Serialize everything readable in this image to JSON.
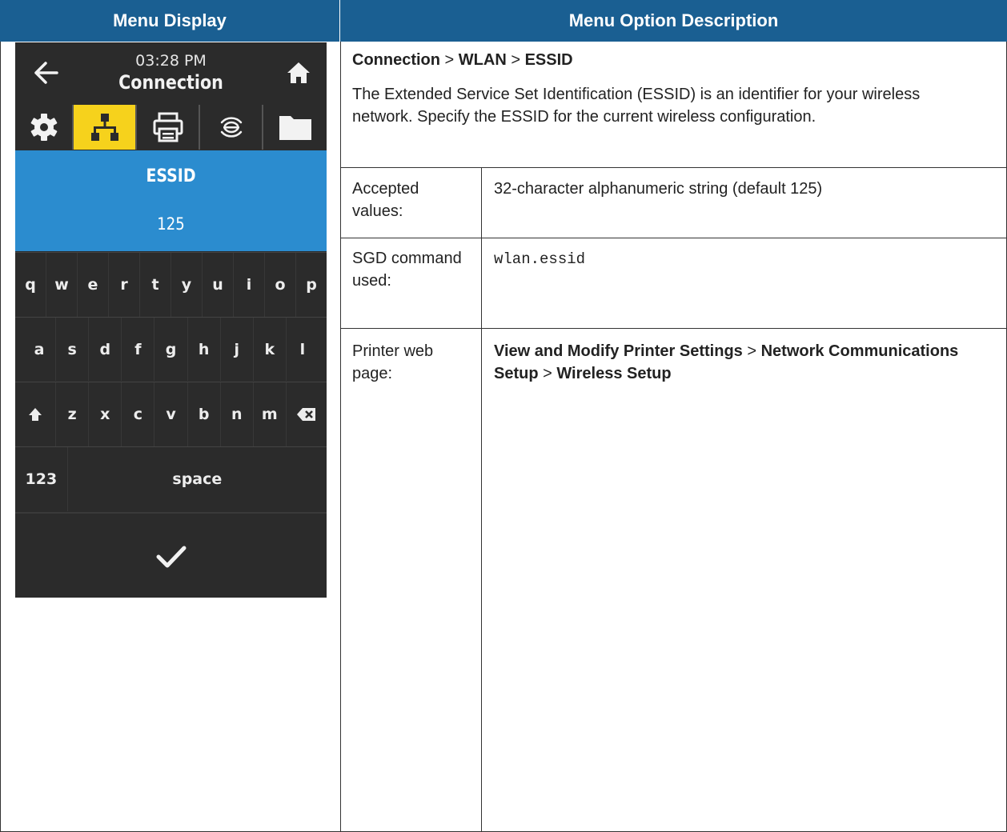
{
  "header": {
    "left": "Menu Display",
    "right": "Menu Option Description"
  },
  "device": {
    "time": "03:28 PM",
    "title": "Connection",
    "tabs": [
      "gear-icon",
      "network-icon",
      "printer-icon",
      "wireless-icon",
      "folder-icon"
    ],
    "active_tab": "network-icon",
    "selection": {
      "label": "ESSID",
      "value": "125"
    },
    "keyboard": {
      "row1": [
        "q",
        "w",
        "e",
        "r",
        "t",
        "y",
        "u",
        "i",
        "o",
        "p"
      ],
      "row2": [
        "a",
        "s",
        "d",
        "f",
        "g",
        "h",
        "j",
        "k",
        "l"
      ],
      "row3": [
        "z",
        "x",
        "c",
        "v",
        "b",
        "n",
        "m"
      ],
      "numbers_key": "123",
      "space_key": "space"
    },
    "colors": {
      "active_tab": "#f6d21c",
      "selection_bg": "#2b8ccf",
      "screen_bg": "#2b2b2b"
    }
  },
  "description": {
    "path": {
      "p1": "Connection",
      "sep1": " > ",
      "p2": "WLAN",
      "sep2": " > ",
      "p3": "ESSID"
    },
    "text": "The Extended Service Set Identification (ESSID) is an identifier for your wireless network. Specify the ESSID for the current wireless configuration.",
    "rows": [
      {
        "label": "Accepted values:",
        "value": "32-character alphanumeric string (default 125)"
      },
      {
        "label": "SGD command used:",
        "value": "wlan.essid"
      },
      {
        "label": "Printer web page:",
        "value_parts": {
          "a": "View and Modify Printer Settings",
          "s1": " > ",
          "b": "Network Communications Setup",
          "s2": " > ",
          "c": "Wireless Setup"
        }
      }
    ]
  },
  "brand_color": "#1a5f92"
}
